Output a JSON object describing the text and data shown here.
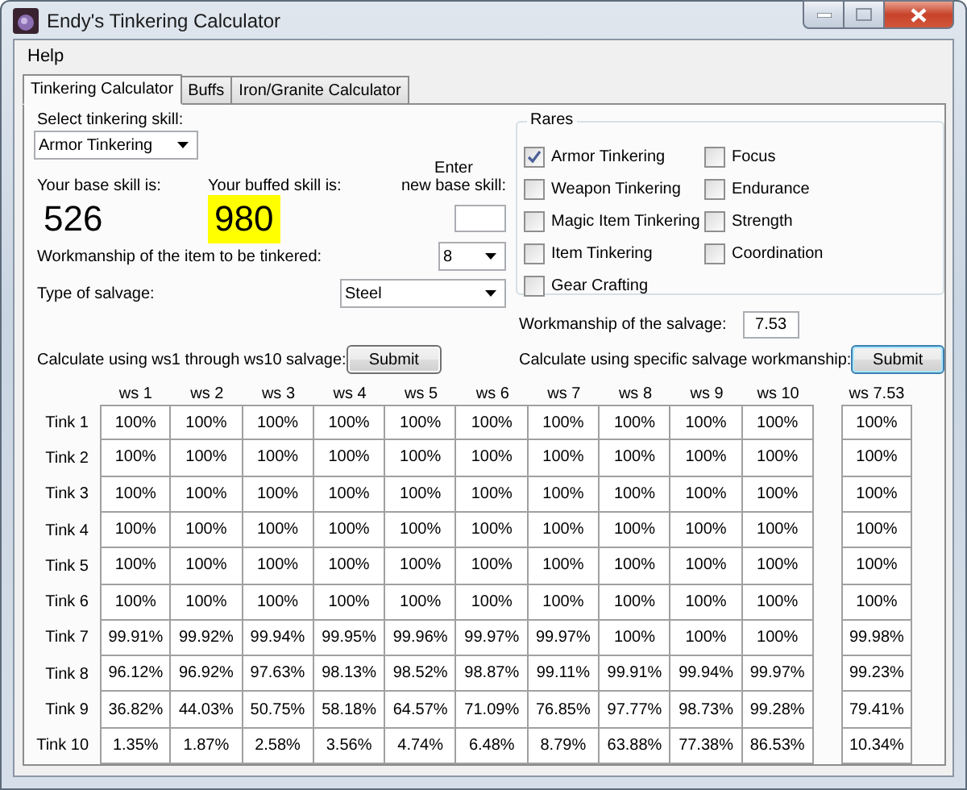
{
  "window": {
    "title": "Endy's Tinkering Calculator"
  },
  "menu": [
    "Help"
  ],
  "tabs": [
    {
      "label": "Tinkering Calculator",
      "selected": true
    },
    {
      "label": "Buffs",
      "selected": false
    },
    {
      "label": "Iron/Granite Calculator",
      "selected": false
    }
  ],
  "skill_select": {
    "label": "Select tinkering skill:",
    "value": "Armor Tinkering"
  },
  "base_skill": {
    "label": "Your base skill is:",
    "value": "526"
  },
  "buffed_skill": {
    "label": "Your buffed skill is:",
    "value": "980"
  },
  "new_base_skill": {
    "label_lines": [
      "Enter",
      "new base skill:"
    ]
  },
  "item_workmanship": {
    "label": "Workmanship of the item to be tinkered:",
    "value": "8"
  },
  "salvage_type": {
    "label": "Type of salvage:",
    "value": "Steel"
  },
  "rares": {
    "title": "Rares",
    "options": [
      {
        "label": "Armor Tinkering",
        "checked": true
      },
      {
        "label": "Weapon Tinkering",
        "checked": false
      },
      {
        "label": "Magic Item Tinkering",
        "checked": false
      },
      {
        "label": "Item Tinkering",
        "checked": false
      },
      {
        "label": "Gear Crafting",
        "checked": false
      },
      {
        "label": "Focus",
        "checked": false
      },
      {
        "label": "Endurance",
        "checked": false
      },
      {
        "label": "Strength",
        "checked": false
      },
      {
        "label": "Coordination",
        "checked": false
      }
    ]
  },
  "salvage_workmanship": {
    "label": "Workmanship of the salvage:",
    "value": "7.53"
  },
  "calc_range": {
    "label": "Calculate using ws1 through ws10 salvage:",
    "button": "Submit"
  },
  "calc_specific": {
    "label": "Calculate using specific salvage workmanship:",
    "button": "Submit"
  },
  "table": {
    "columns": [
      "ws 1",
      "ws 2",
      "ws 3",
      "ws 4",
      "ws 5",
      "ws 6",
      "ws 7",
      "ws 8",
      "ws 9",
      "ws 10"
    ],
    "extra_column": "ws 7.53",
    "rows": [
      {
        "label": "Tink 1",
        "values": [
          "100%",
          "100%",
          "100%",
          "100%",
          "100%",
          "100%",
          "100%",
          "100%",
          "100%",
          "100%"
        ],
        "extra": "100%"
      },
      {
        "label": "Tink 2",
        "values": [
          "100%",
          "100%",
          "100%",
          "100%",
          "100%",
          "100%",
          "100%",
          "100%",
          "100%",
          "100%"
        ],
        "extra": "100%"
      },
      {
        "label": "Tink 3",
        "values": [
          "100%",
          "100%",
          "100%",
          "100%",
          "100%",
          "100%",
          "100%",
          "100%",
          "100%",
          "100%"
        ],
        "extra": "100%"
      },
      {
        "label": "Tink 4",
        "values": [
          "100%",
          "100%",
          "100%",
          "100%",
          "100%",
          "100%",
          "100%",
          "100%",
          "100%",
          "100%"
        ],
        "extra": "100%"
      },
      {
        "label": "Tink 5",
        "values": [
          "100%",
          "100%",
          "100%",
          "100%",
          "100%",
          "100%",
          "100%",
          "100%",
          "100%",
          "100%"
        ],
        "extra": "100%"
      },
      {
        "label": "Tink 6",
        "values": [
          "100%",
          "100%",
          "100%",
          "100%",
          "100%",
          "100%",
          "100%",
          "100%",
          "100%",
          "100%"
        ],
        "extra": "100%"
      },
      {
        "label": "Tink 7",
        "values": [
          "99.91%",
          "99.92%",
          "99.94%",
          "99.95%",
          "99.96%",
          "99.97%",
          "99.97%",
          "100%",
          "100%",
          "100%"
        ],
        "extra": "99.98%"
      },
      {
        "label": "Tink 8",
        "values": [
          "96.12%",
          "96.92%",
          "97.63%",
          "98.13%",
          "98.52%",
          "98.87%",
          "99.11%",
          "99.91%",
          "99.94%",
          "99.97%"
        ],
        "extra": "99.23%"
      },
      {
        "label": "Tink 9",
        "values": [
          "36.82%",
          "44.03%",
          "50.75%",
          "58.18%",
          "64.57%",
          "71.09%",
          "76.85%",
          "97.77%",
          "98.73%",
          "99.28%"
        ],
        "extra": "79.41%"
      },
      {
        "label": "Tink 10",
        "values": [
          "1.35%",
          "1.87%",
          "2.58%",
          "3.56%",
          "4.74%",
          "6.48%",
          "8.79%",
          "63.88%",
          "77.38%",
          "86.53%"
        ],
        "extra": "10.34%"
      }
    ]
  }
}
